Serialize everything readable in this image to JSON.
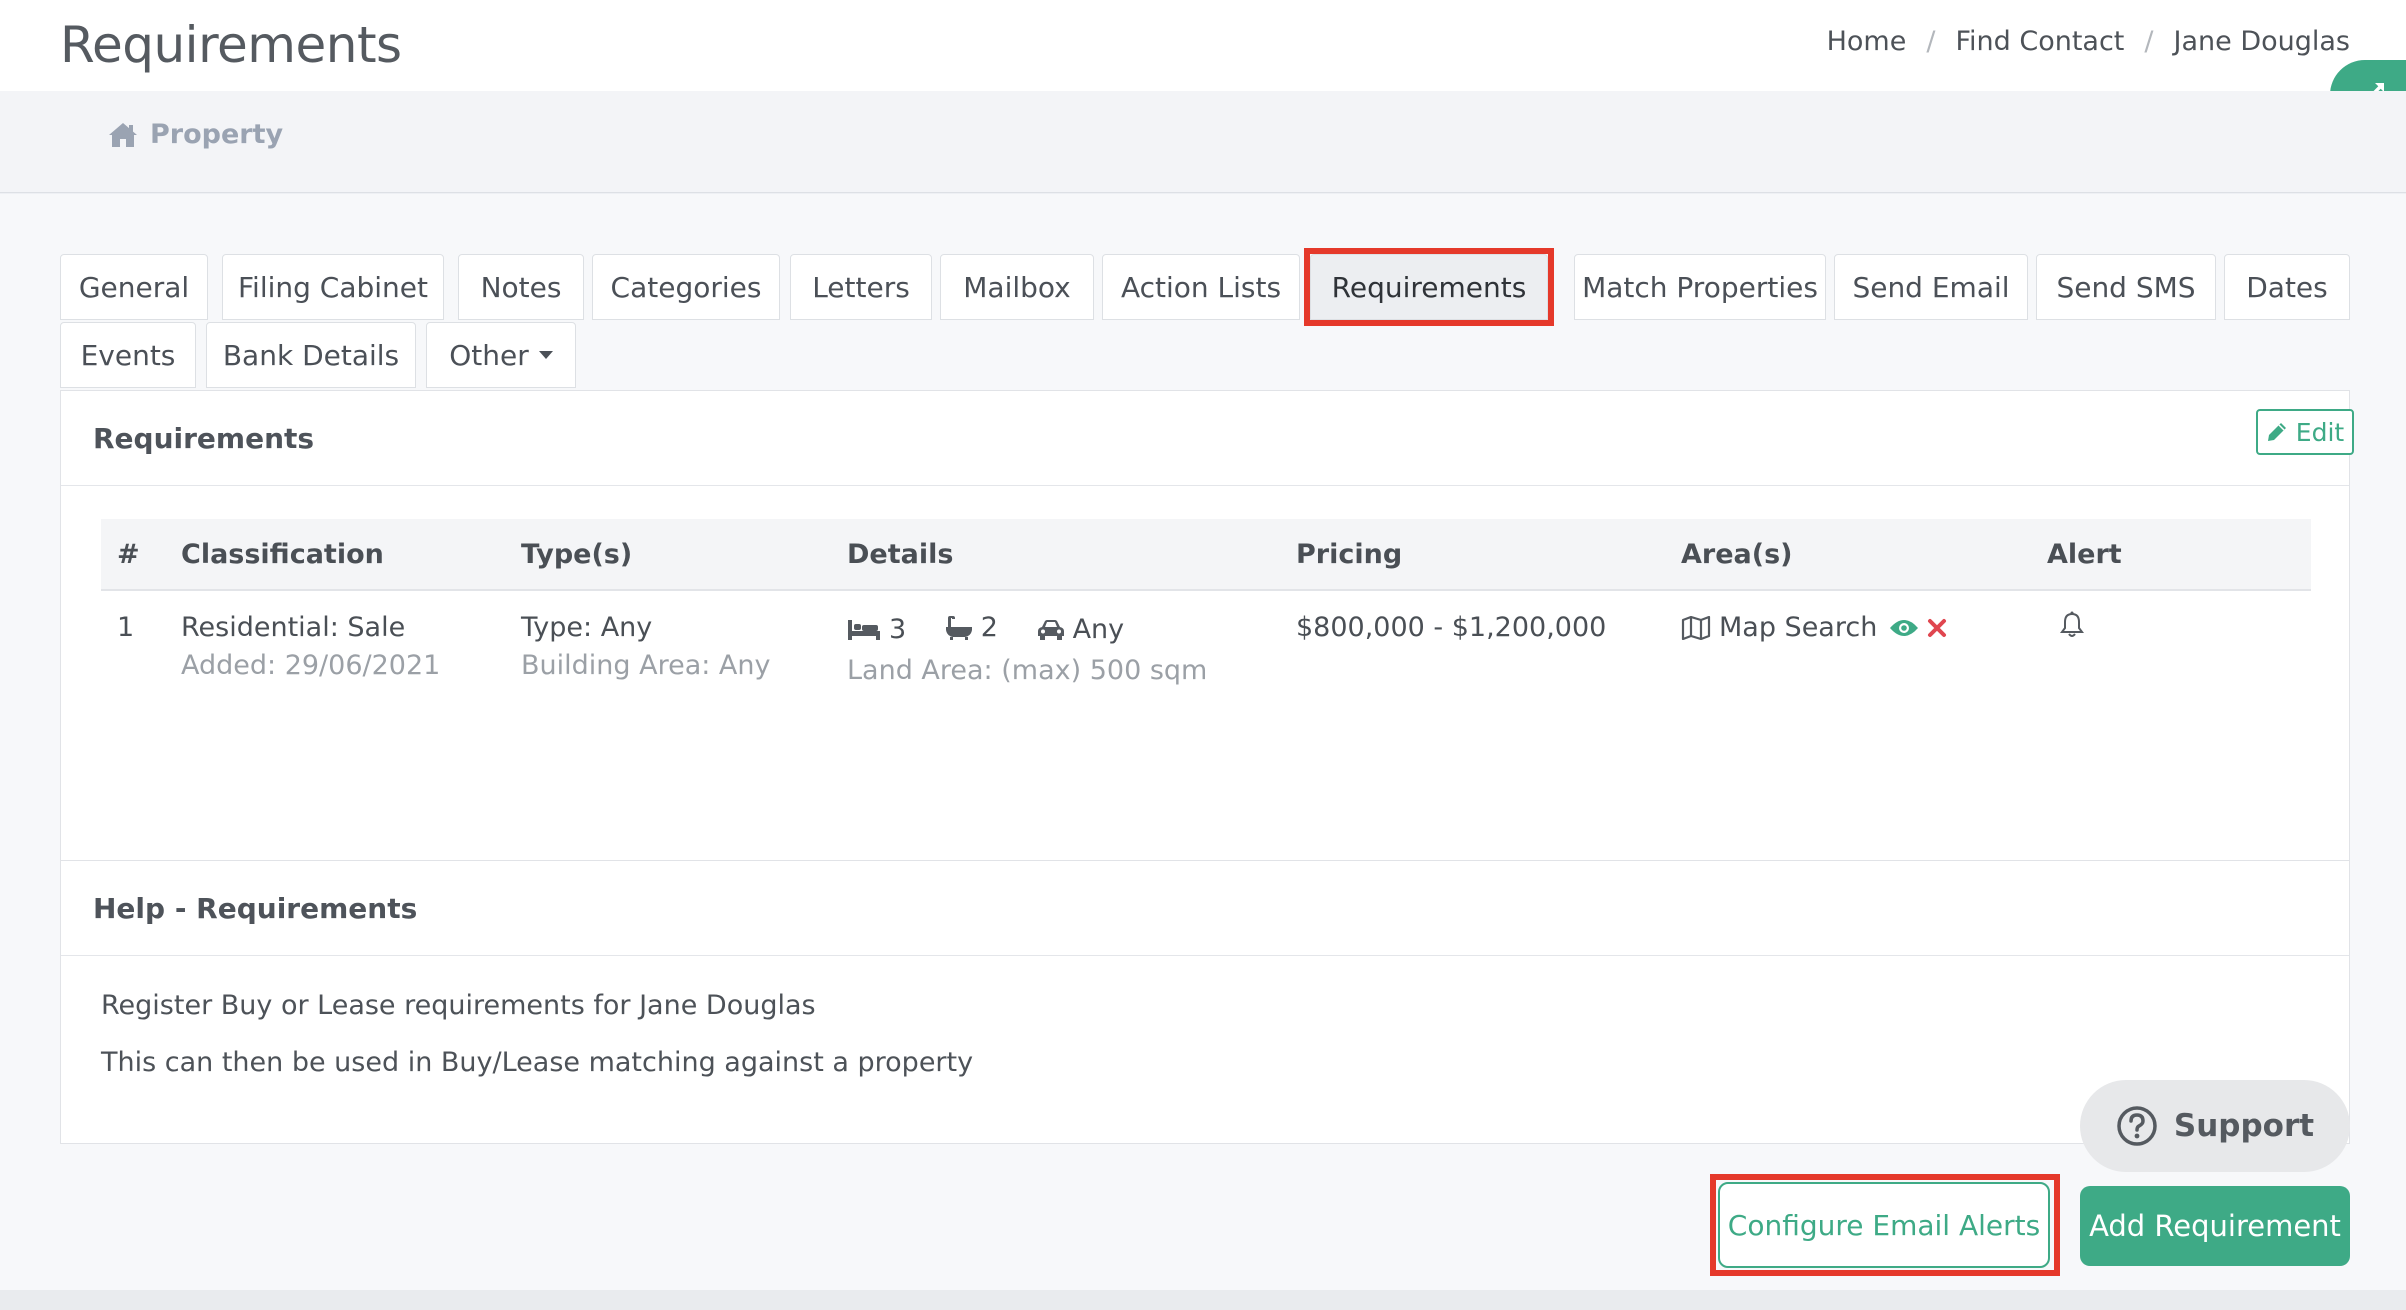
{
  "header": {
    "title": "Requirements",
    "breadcrumb": [
      "Home",
      "Find Contact",
      "Jane Douglas"
    ],
    "breadcrumb_separator": "/",
    "expand_icon": "expand-arrows-icon"
  },
  "subnav": {
    "label": "Property",
    "icon": "home-icon"
  },
  "tabs": [
    {
      "label": "General"
    },
    {
      "label": "Filing Cabinet"
    },
    {
      "label": "Notes"
    },
    {
      "label": "Categories"
    },
    {
      "label": "Letters"
    },
    {
      "label": "Mailbox"
    },
    {
      "label": "Action Lists"
    },
    {
      "label": "Requirements",
      "active": true
    },
    {
      "label": "Match Properties"
    },
    {
      "label": "Send Email"
    },
    {
      "label": "Send SMS"
    },
    {
      "label": "Dates"
    },
    {
      "label": "Events"
    },
    {
      "label": "Bank Details"
    },
    {
      "label": "Other"
    }
  ],
  "requirements_panel": {
    "title": "Requirements",
    "columns": [
      "#",
      "Classification",
      "Type(s)",
      "Details",
      "Pricing",
      "Area(s)",
      "Alert"
    ],
    "rows": [
      {
        "index": "1",
        "classification": "Residential: Sale",
        "added": "Added: 29/06/2021",
        "type": "Type: Any",
        "building_area": "Building Area: Any",
        "beds": "3",
        "baths": "2",
        "cars": "Any",
        "land_area": "Land Area: (max) 500 sqm",
        "pricing": "$800,000 - $1,200,000",
        "area": "Map Search",
        "edit_label": "Edit"
      }
    ]
  },
  "help_panel": {
    "title": "Help - Requirements",
    "lines": [
      "Register Buy or Lease requirements for Jane Douglas",
      "This can then be used in Buy/Lease matching against a property"
    ]
  },
  "buttons": {
    "support": "Support",
    "configure_alerts": "Configure Email Alerts",
    "add_requirement": "Add Requirement"
  },
  "colors": {
    "accent": "#3eaa86",
    "highlight": "#e5392a",
    "danger": "#e0464f"
  }
}
